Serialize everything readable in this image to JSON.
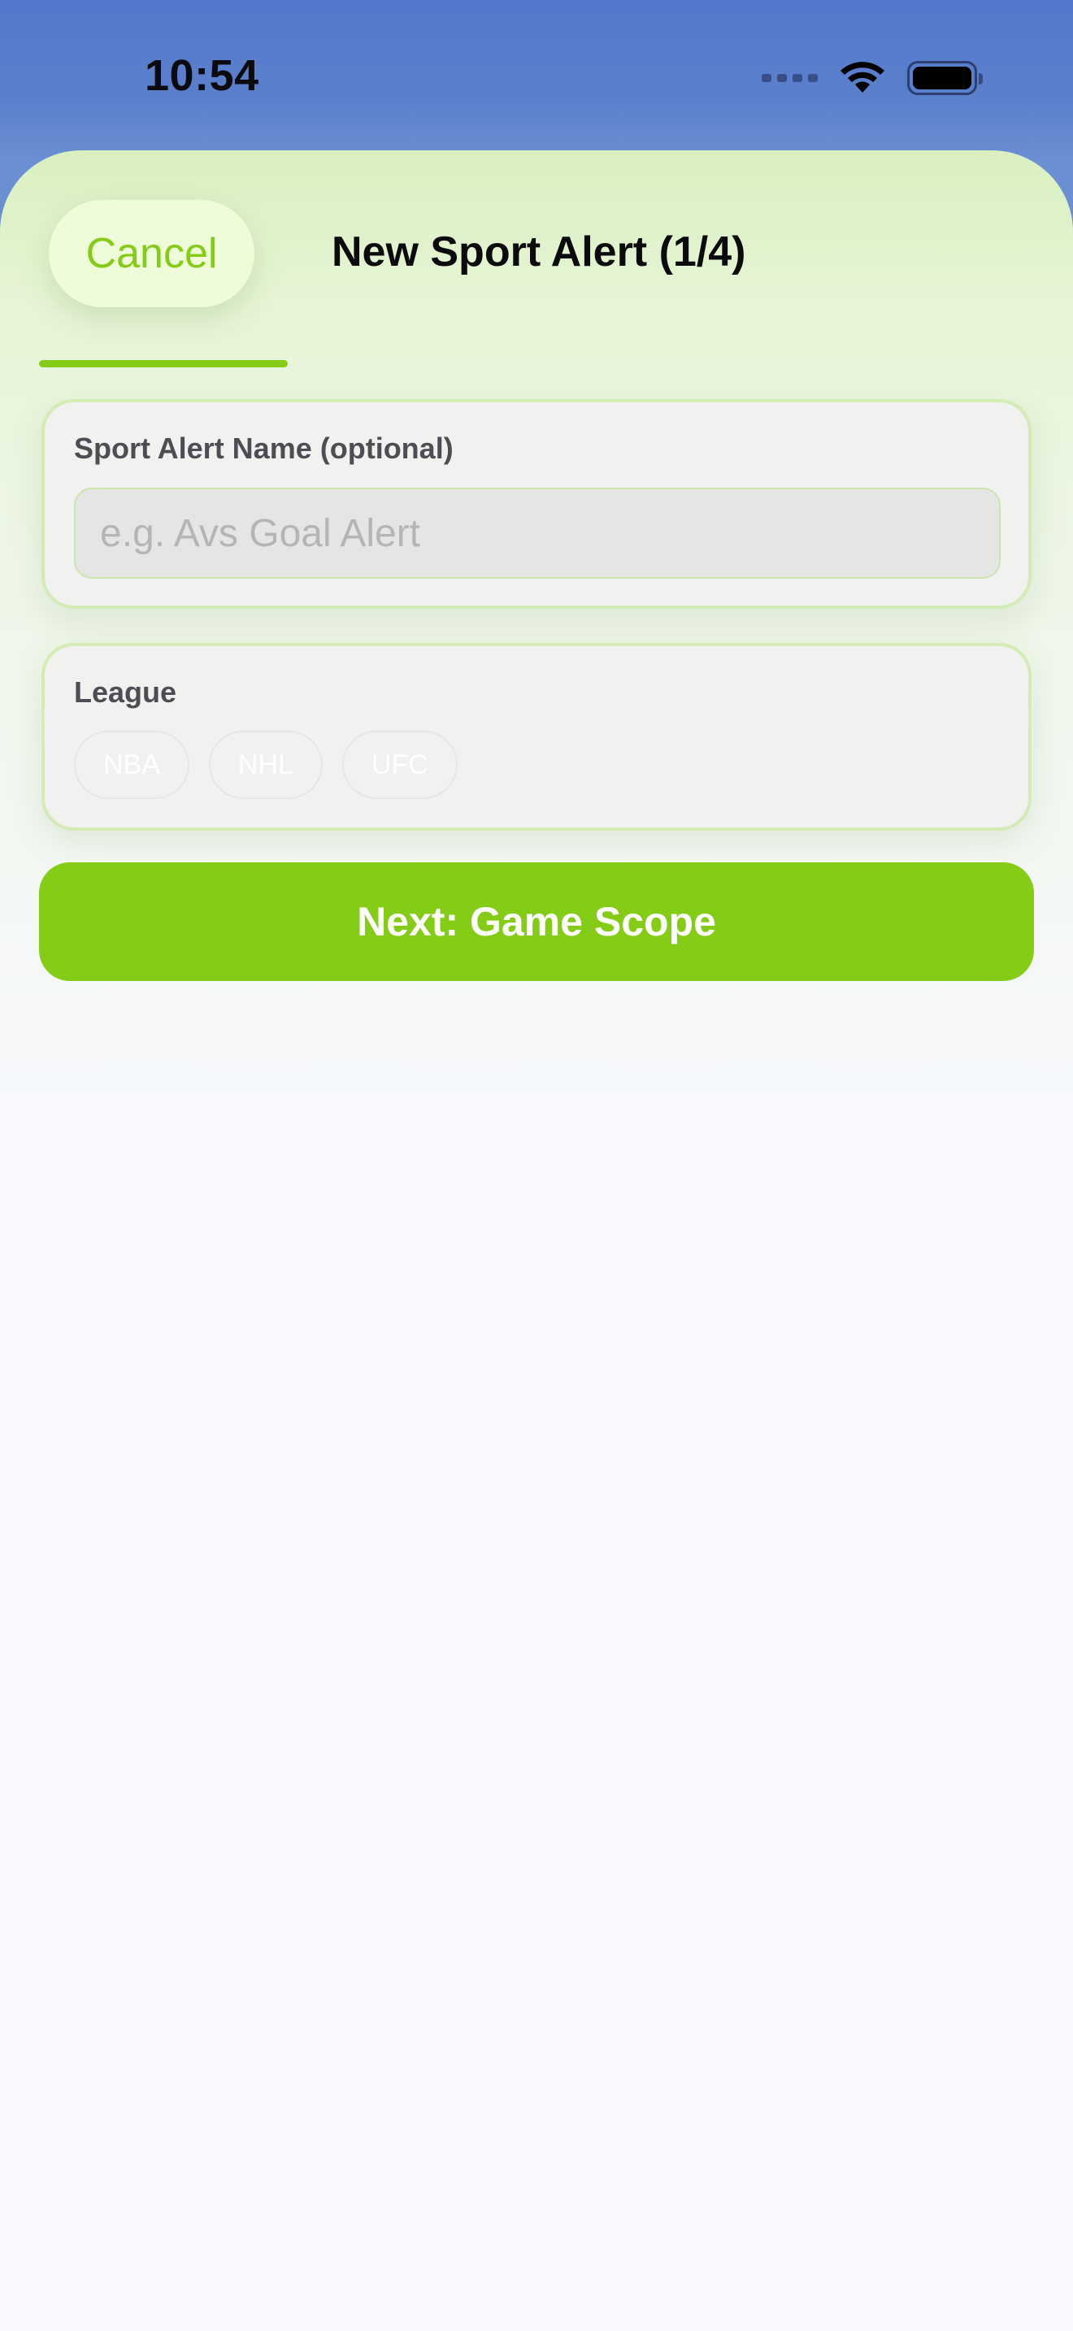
{
  "status_bar": {
    "time": "10:54",
    "icons": [
      "cellular-signal-icon",
      "wifi-icon",
      "battery-icon"
    ],
    "battery_level": 1.0
  },
  "header": {
    "cancel_label": "Cancel",
    "title": "New Sport Alert (1/4)"
  },
  "progress": {
    "current_step": 1,
    "total_steps": 4
  },
  "name_card": {
    "label": "Sport Alert Name (optional)",
    "input_value": "",
    "placeholder": "e.g. Avs Goal Alert"
  },
  "league_card": {
    "label": "League",
    "options": [
      {
        "label": "NBA"
      },
      {
        "label": "NHL"
      },
      {
        "label": "UFC"
      }
    ],
    "selected": ""
  },
  "next_button": {
    "label": "Next: Game Scope"
  },
  "colors": {
    "accent": "#84cc16",
    "cancel_background": "#eefcd9",
    "top_background": "#5378cc",
    "card_background": "#f1f1f0",
    "card_border": "#d2ecb3"
  }
}
